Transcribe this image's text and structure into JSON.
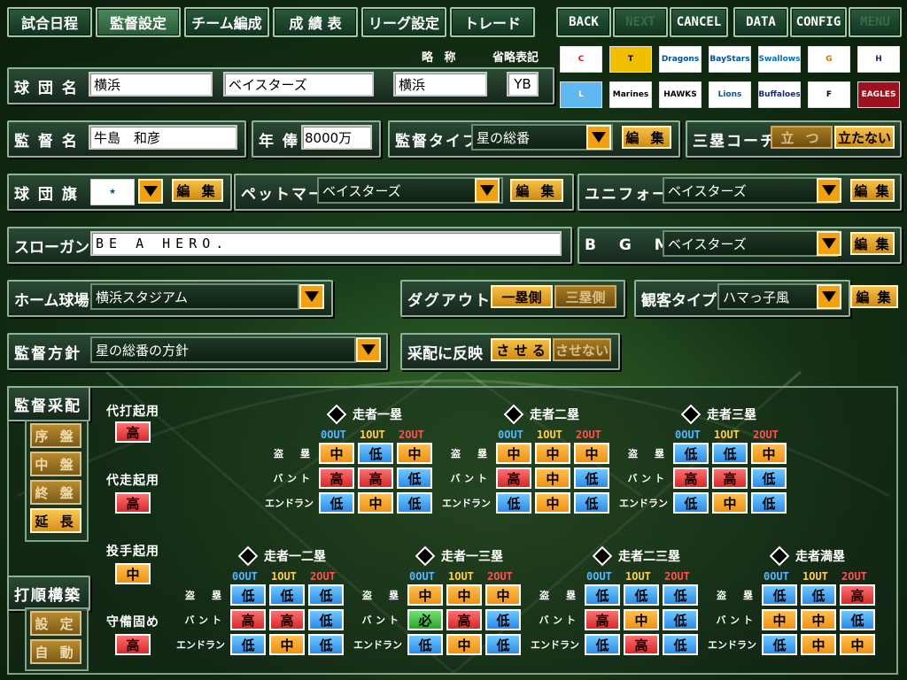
{
  "nav": {
    "tabs": [
      "試合日程",
      "監督設定",
      "チーム編成",
      "成 績 表",
      "リーグ設定",
      "トレード"
    ],
    "active_tab": "監督設定",
    "actions": [
      "BACK",
      "NEXT",
      "CANCEL",
      "DATA",
      "CONFIG",
      "MENU"
    ]
  },
  "team": {
    "name_label": "球 団 名",
    "city": "横浜",
    "nickname": "ベイスターズ",
    "abbr_header": "略 称",
    "short_header": "省略表記",
    "abbr": "横浜",
    "short": "YB"
  },
  "manager": {
    "name_label": "監 督 名",
    "name": "牛島　和彦",
    "salary_label": "年 俸",
    "salary": "8000万",
    "type_label": "監督タイプ",
    "type": "星の総番",
    "edit": "編 集",
    "coach_label": "三塁コーチ",
    "coach_on": "立 つ",
    "coach_off": "立たない"
  },
  "flag": {
    "label": "球 団 旗",
    "edit": "編 集",
    "pet_label": "ペットマーク",
    "pet": "ベイスターズ",
    "pet_edit": "編 集",
    "uniform_label": "ユニフォーム",
    "uniform": "ベイスターズ",
    "uniform_edit": "編 集"
  },
  "slogan": {
    "label": "スローガン",
    "value": "BE  A  HERO.",
    "bgm_label": "B G M",
    "bgm": "ベイスターズ",
    "bgm_edit": "編 集"
  },
  "stadium": {
    "label": "ホーム球場",
    "value": "横浜スタジアム",
    "dugout_label": "ダグアウト",
    "dugout_1b": "一塁側",
    "dugout_3b": "三塁側",
    "crowd_label": "観客タイプ",
    "crowd": "ハマっ子風",
    "crowd_edit": "編 集"
  },
  "policy": {
    "label": "監督方針",
    "value": "星の総番の方針",
    "reflect_label": "采配に反映",
    "reflect_on": "さ せ る",
    "reflect_off": "させない"
  },
  "logos": [
    {
      "name": "carp-logo",
      "text": "C",
      "bg": "#ffffff",
      "fg": "#e02020"
    },
    {
      "name": "tigers-logo",
      "text": "T",
      "bg": "#f0c000",
      "fg": "#000000"
    },
    {
      "name": "dragons-logo",
      "text": "Dragons",
      "bg": "#ffffff",
      "fg": "#0050a0"
    },
    {
      "name": "baystars-logo",
      "text": "BayStars",
      "bg": "#ffffff",
      "fg": "#0050a0"
    },
    {
      "name": "swallows-logo",
      "text": "Swallows",
      "bg": "#ffffff",
      "fg": "#0070c0"
    },
    {
      "name": "giants-logo",
      "text": "G",
      "bg": "#ffffff",
      "fg": "#e07000"
    },
    {
      "name": "fighters-logo",
      "text": "H",
      "bg": "#ffffff",
      "fg": "#1a2a80"
    },
    {
      "name": "lions-blue-logo",
      "text": "L",
      "bg": "#60b8f0",
      "fg": "#ffffff"
    },
    {
      "name": "marines-logo",
      "text": "Marines",
      "bg": "#ffffff",
      "fg": "#000000"
    },
    {
      "name": "hawks-logo",
      "text": "HAWKS",
      "bg": "#ffffff",
      "fg": "#000000"
    },
    {
      "name": "lions-logo",
      "text": "Lions",
      "bg": "#ffffff",
      "fg": "#1a4a90"
    },
    {
      "name": "buffaloes-logo",
      "text": "Buffaloes",
      "bg": "#ffffff",
      "fg": "#1a2a70"
    },
    {
      "name": "fighters-bear-logo",
      "text": "F",
      "bg": "#ffffff",
      "fg": "#000000"
    },
    {
      "name": "eagles-logo",
      "text": "EAGLES",
      "bg": "#a01020",
      "fg": "#ffffff"
    }
  ],
  "strategy": {
    "title": "監督采配",
    "phases": [
      "序 盤",
      "中 盤",
      "終 盤",
      "延 長"
    ],
    "active_phase": 3,
    "lineup_title": "打順構築",
    "lineup_buttons": [
      "設 定",
      "自 動"
    ],
    "pinch_hit_label": "代打起用",
    "pinch_hit": "高",
    "pinch_run_label": "代走起用",
    "pinch_run": "高",
    "pitcher_label": "投手起用",
    "pitcher": "中",
    "defense_label": "守備固め",
    "defense": "高",
    "col_headers": [
      "0OUT",
      "1OUT",
      "2OUT"
    ],
    "row_labels": [
      "盗　塁",
      "バント",
      "エンドラン"
    ],
    "groups": [
      {
        "title": "走者一塁",
        "cells": [
          [
            "中",
            "低",
            "中"
          ],
          [
            "高",
            "高",
            "低"
          ],
          [
            "低",
            "中",
            "低"
          ]
        ]
      },
      {
        "title": "走者二塁",
        "cells": [
          [
            "中",
            "中",
            "中"
          ],
          [
            "高",
            "中",
            "低"
          ],
          [
            "低",
            "中",
            "低"
          ]
        ]
      },
      {
        "title": "走者三塁",
        "cells": [
          [
            "低",
            "低",
            "中"
          ],
          [
            "高",
            "高",
            "低"
          ],
          [
            "低",
            "中",
            "低"
          ]
        ]
      },
      {
        "title": "走者一二塁",
        "cells": [
          [
            "低",
            "低",
            "低"
          ],
          [
            "高",
            "高",
            "低"
          ],
          [
            "低",
            "中",
            "低"
          ]
        ]
      },
      {
        "title": "走者一三塁",
        "cells": [
          [
            "中",
            "中",
            "中"
          ],
          [
            "必",
            "高",
            "低"
          ],
          [
            "低",
            "中",
            "低"
          ]
        ]
      },
      {
        "title": "走者二三塁",
        "cells": [
          [
            "低",
            "低",
            "低"
          ],
          [
            "高",
            "中",
            "低"
          ],
          [
            "低",
            "高",
            "低"
          ]
        ]
      },
      {
        "title": "走者満塁",
        "cells": [
          [
            "低",
            "低",
            "高"
          ],
          [
            "中",
            "中",
            "低"
          ],
          [
            "低",
            "中",
            "中"
          ]
        ]
      }
    ],
    "colors": {
      "高": "#d82828",
      "中": "#f09010",
      "低": "#2a8ae8",
      "必": "#28a828"
    },
    "header_colors": [
      "#50b8ff",
      "#ffd040",
      "#ff5050"
    ]
  }
}
